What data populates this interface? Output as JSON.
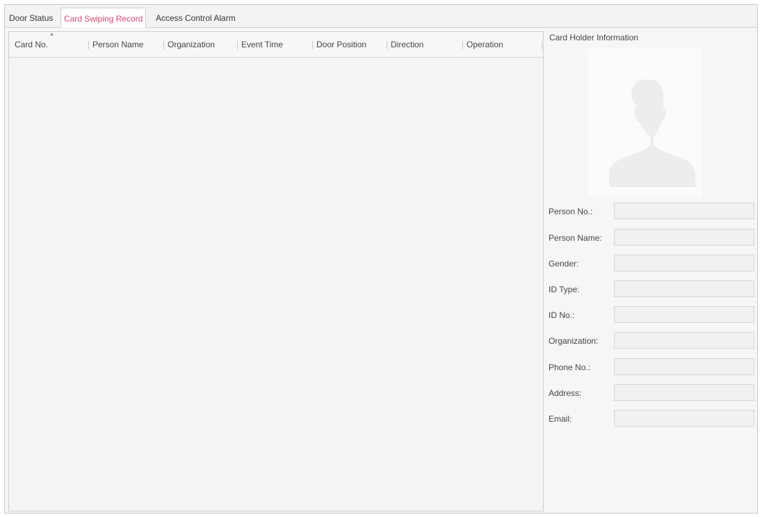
{
  "tabs": [
    {
      "label": "Door Status"
    },
    {
      "label": "Card Swiping Record",
      "active": true
    },
    {
      "label": "Access Control Alarm"
    }
  ],
  "table": {
    "columns": [
      "Card No.",
      "Person Name",
      "Organization",
      "Event Time",
      "Door Position",
      "Direction",
      "Operation"
    ],
    "rows": []
  },
  "card_holder": {
    "title": "Card Holder Information",
    "photo_icon": "person-silhouette-icon",
    "fields": [
      {
        "label": "Person No.:",
        "value": ""
      },
      {
        "label": "Person Name:",
        "value": ""
      },
      {
        "label": "Gender:",
        "value": ""
      },
      {
        "label": "ID Type:",
        "value": ""
      },
      {
        "label": "ID No.:",
        "value": ""
      },
      {
        "label": "Organization:",
        "value": ""
      },
      {
        "label": "Phone No.:",
        "value": ""
      },
      {
        "label": "Address:",
        "value": ""
      },
      {
        "label": "Email:",
        "value": ""
      }
    ]
  },
  "colors": {
    "active_tab_text": "#d14a6e",
    "panel_background": "#f6f6f6",
    "border": "#cfcfcf"
  }
}
